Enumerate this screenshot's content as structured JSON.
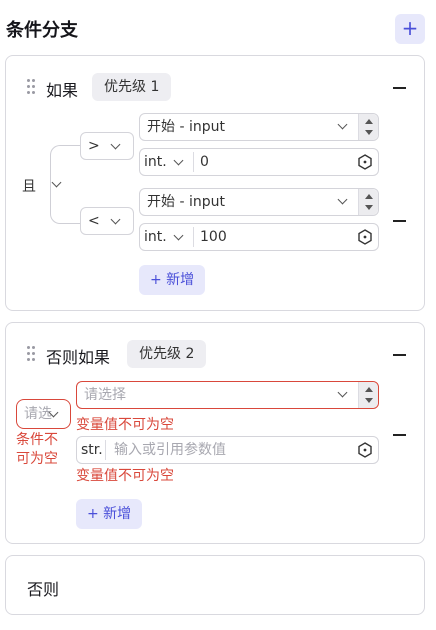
{
  "header": {
    "title": "条件分支",
    "add_icon": "plus-icon",
    "add_symbol": "+"
  },
  "branch1": {
    "title": "如果",
    "priority": "优先级 1",
    "logic": "且",
    "conditions": [
      {
        "operator": ">",
        "variable": "开始 - input",
        "type": "int.",
        "value": "0"
      },
      {
        "operator": "<",
        "variable": "开始 - input",
        "type": "int.",
        "value": "100"
      }
    ],
    "add_label": "+ 新增"
  },
  "branch2": {
    "title": "否则如果",
    "priority": "优先级 2",
    "logic_placeholder": "请选",
    "logic_error": [
      "条件不",
      "可为空"
    ],
    "variable_placeholder": "请选择",
    "variable_error": "变量值不可为空",
    "type": "str.",
    "value_placeholder": "输入或引用参数值",
    "value_error": "变量值不可为空",
    "add_label": "+ 新增"
  },
  "else_branch": {
    "title": "否则"
  },
  "colors": {
    "accent": "#4a4fd9",
    "accent_bg": "#e7e8fb",
    "error": "#d9483b",
    "border": "#d9d9df"
  }
}
